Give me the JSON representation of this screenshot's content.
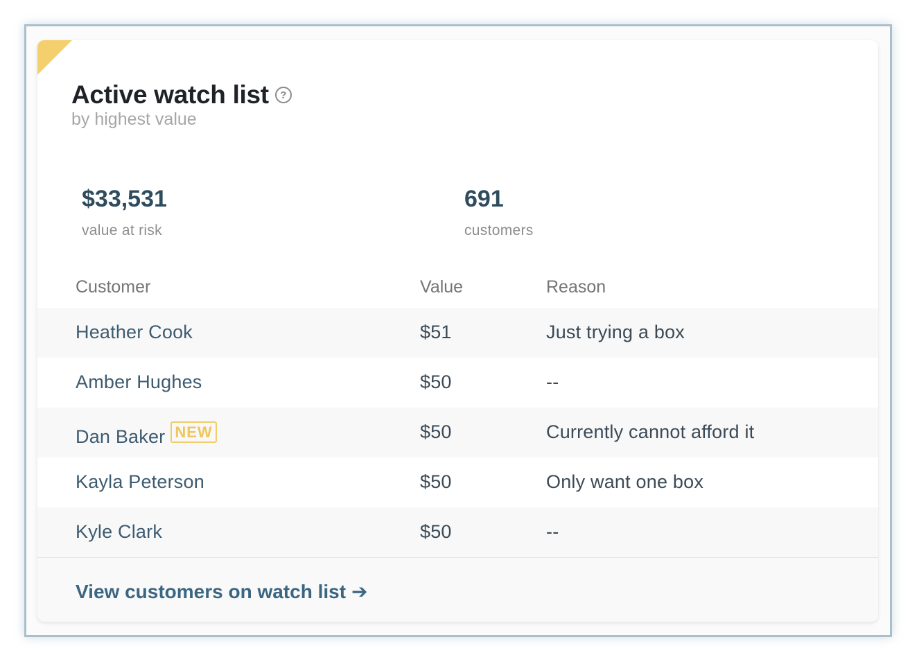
{
  "card": {
    "title": "Active watch list",
    "subtitle": "by highest value",
    "help_icon": "question-circle-icon"
  },
  "stats": [
    {
      "value": "$33,531",
      "label": "value at risk"
    },
    {
      "value": "691",
      "label": "customers"
    }
  ],
  "table": {
    "headers": [
      "Customer",
      "Value",
      "Reason"
    ],
    "rows": [
      {
        "customer": "Heather Cook",
        "value": "$51",
        "reason": "Just trying a box",
        "badge": ""
      },
      {
        "customer": "Amber Hughes",
        "value": "$50",
        "reason": "--",
        "badge": ""
      },
      {
        "customer": "Dan Baker",
        "value": "$50",
        "reason": "Currently cannot afford it",
        "badge": "NEW"
      },
      {
        "customer": "Kayla Peterson",
        "value": "$50",
        "reason": "Only want one box",
        "badge": ""
      },
      {
        "customer": "Kyle Clark",
        "value": "$50",
        "reason": "--",
        "badge": ""
      }
    ]
  },
  "footer": {
    "link_label": "View customers on watch list",
    "arrow": "➔"
  },
  "colors": {
    "accent_corner": "#f4cf6e",
    "link": "#3b6682",
    "badge": "#efc65a"
  }
}
